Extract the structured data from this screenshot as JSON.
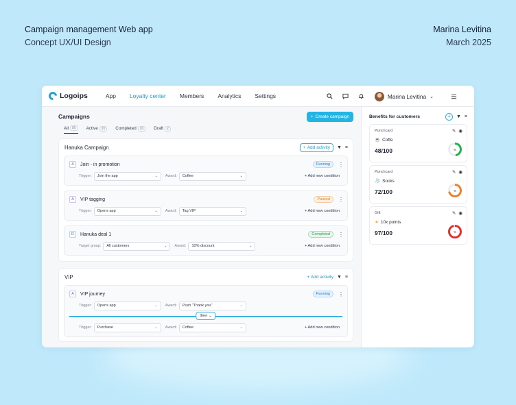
{
  "caption": {
    "title": "Campaign management Web app",
    "subtitle": "Concept UX/UI Design",
    "author": "Marina Levitina",
    "date": "March 2025"
  },
  "topbar": {
    "logo": "Logoips",
    "nav": [
      "App",
      "Loyalty center",
      "Members",
      "Analytics",
      "Settings"
    ],
    "active_nav": "Loyalty center",
    "user_name": "Marina Levitina"
  },
  "main": {
    "title": "Campaigns",
    "create_button": "Create campaign",
    "tabs": [
      {
        "label": "All",
        "count": "80"
      },
      {
        "label": "Active",
        "count": "20"
      },
      {
        "label": "Completed",
        "count": "20"
      },
      {
        "label": "Draft",
        "count": "2"
      }
    ]
  },
  "campaign1": {
    "title": "Hanuka Campaign",
    "add_activity": "Add activity",
    "activities": [
      {
        "badge": "A",
        "name": "Join - in promotion",
        "status": "Running",
        "label1": "Trigger:",
        "value1": "Join the app",
        "label2": "Award:",
        "value2": "Coffee",
        "add": "Add new condition"
      },
      {
        "badge": "A",
        "name": "VIP tagging",
        "status": "Paused",
        "label1": "Trigger:",
        "value1": "Opens app",
        "label2": "Award:",
        "value2": "Tag VIP",
        "add": "Add new condition"
      },
      {
        "badge": "D",
        "name": "Hanuka deal 1",
        "status": "Completed",
        "label1": "Target group:",
        "value1": "All customers",
        "label2": "Award:",
        "value2": "10% discount",
        "add": "Add new condition"
      }
    ]
  },
  "campaign2": {
    "title": "VIP",
    "add_activity": "Add activity",
    "activity": {
      "badge": "A",
      "name": "VIP journey",
      "status": "Running",
      "row1": {
        "label1": "Trigger:",
        "value1": "Opens app",
        "label2": "Award:",
        "value2": "Push \"Thank you\""
      },
      "then": "then",
      "row2": {
        "label1": "Trigger:",
        "value1": "Purchase",
        "label2": "Award:",
        "value2": "Coffee",
        "add": "Add new condition"
      }
    }
  },
  "benefits": {
    "title": "Benefits for customers",
    "cards": [
      {
        "type": "Punchcard",
        "name": "Coffe",
        "value": "48/100",
        "percent": 48,
        "color": "#22b04b",
        "ring_label": "%"
      },
      {
        "type": "Punchcard",
        "name": "Socks",
        "value": "72/100",
        "percent": 72,
        "color": "#f07f2a",
        "ring_label": "%"
      },
      {
        "type": "Gift",
        "name": "10x points",
        "value": "97/100",
        "percent": 97,
        "color": "#e0302e",
        "ring_label": "%"
      }
    ]
  }
}
